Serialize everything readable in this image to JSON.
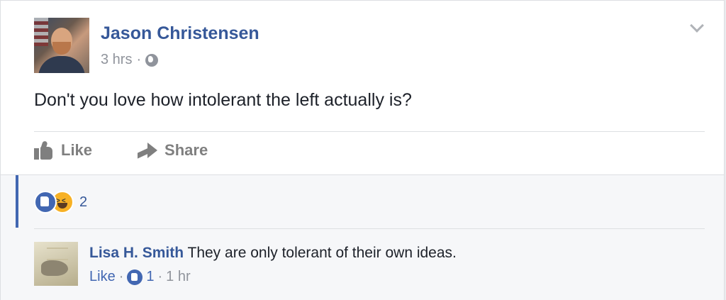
{
  "post": {
    "author": "Jason Christensen",
    "time": "3 hrs",
    "separator": "·",
    "text": "Don't you love how intolerant the left actually is?",
    "actions": {
      "like": "Like",
      "share": "Share"
    }
  },
  "reactions": {
    "count": "2"
  },
  "comment": {
    "author": "Lisa H. Smith",
    "text": "They are only tolerant of their own ideas.",
    "like_label": "Like",
    "separator": "·",
    "like_count": "1",
    "time": "1 hr"
  },
  "colors": {
    "link": "#365899",
    "accent": "#4267b2",
    "muted": "#90949c"
  }
}
